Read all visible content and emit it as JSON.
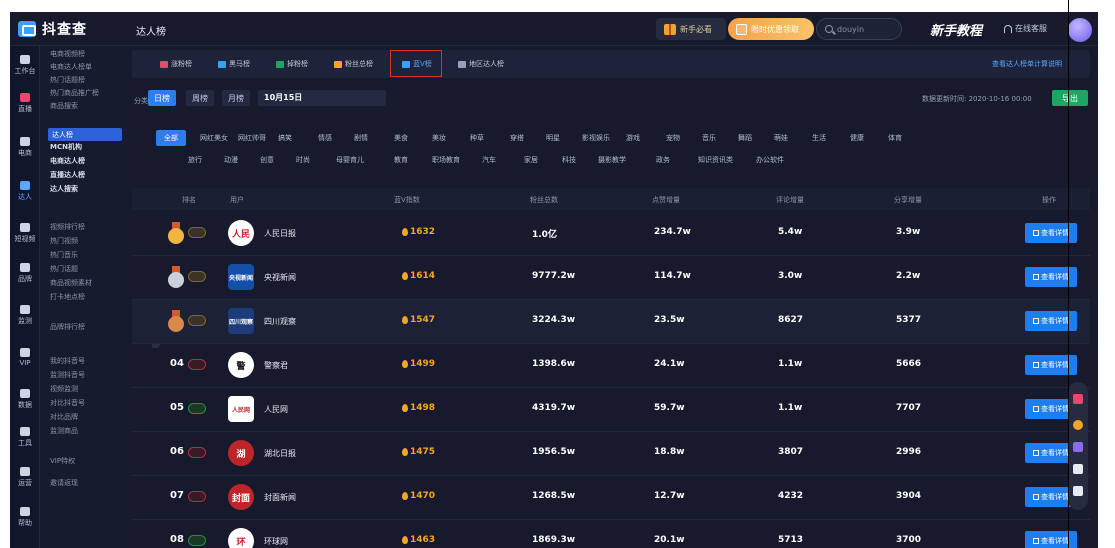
{
  "app": {
    "brand": "抖查查",
    "breadcrumb": "达人榜",
    "beginner_label": "新手必看",
    "promo_label": "限时优惠领取",
    "search_placeholder": "douyin",
    "tutorial_label": "新手教程",
    "service_label": "在线客服"
  },
  "left_nav": [
    {
      "label": "工作台",
      "icon": "grid-icon",
      "active": false
    },
    {
      "label": "直播",
      "icon": "play-icon",
      "active": false
    },
    {
      "label": "电商",
      "icon": "store-icon",
      "active": false
    },
    {
      "label": "达人",
      "icon": "person-icon",
      "active": true
    },
    {
      "label": "短视频",
      "icon": "video-icon",
      "active": false
    },
    {
      "label": "品牌",
      "icon": "brand-icon",
      "active": false
    },
    {
      "label": "监测",
      "icon": "monitor-icon",
      "active": false
    },
    {
      "label": "VIP",
      "icon": "crown-icon",
      "active": false
    },
    {
      "label": "数据",
      "icon": "chart-icon",
      "active": false
    },
    {
      "label": "工具",
      "icon": "tool-icon",
      "active": false
    },
    {
      "label": "运营",
      "icon": "gear-icon",
      "active": false
    },
    {
      "label": "帮助",
      "icon": "help-icon",
      "active": false
    }
  ],
  "sub_nav": [
    "电商视频榜",
    "电商达人榜单",
    "热门话题榜",
    "热门商品推广榜",
    "商品搜索",
    "达人榜",
    "MCN机构",
    "电商达人榜",
    "直播达人榜",
    "达人搜索",
    "视频排行榜",
    "热门视频",
    "热门音乐",
    "热门话题",
    "商品视频素材",
    "打卡地点榜",
    "品牌排行榜",
    "我的抖音号",
    "监测抖音号",
    "视频监测",
    "对比抖音号",
    "对比品牌",
    "监测商品",
    "VIP特权",
    "邀请返现"
  ],
  "tabs": [
    {
      "label": "涨粉榜",
      "color": "#e9486a"
    },
    {
      "label": "黑马榜",
      "color": "#3aa0ff"
    },
    {
      "label": "掉粉榜",
      "color": "#1fa562"
    },
    {
      "label": "粉丝总榜",
      "color": "#f5a524"
    },
    {
      "label": "蓝V榜",
      "color": "#3aa0ff",
      "active": true
    },
    {
      "label": "地区达人榜",
      "color": "#9aa0b6"
    }
  ],
  "tab_right_link": "查看达人榜单计算说明",
  "periods": [
    "日榜",
    "周榜",
    "月榜"
  ],
  "active_period": "日榜",
  "date_value": "10月15日",
  "update_time": "数据更新时间: 2020-10-16 00:00",
  "export_label": "导出",
  "category_label": "分类:",
  "categories_row1": [
    "全部",
    "网红美女",
    "网红帅哥",
    "搞笑",
    "情感",
    "剧情",
    "美食",
    "美妆",
    "种草",
    "穿搭",
    "明星",
    "影视娱乐",
    "游戏",
    "宠物",
    "音乐",
    "舞蹈",
    "萌娃",
    "生活",
    "健康",
    "体育"
  ],
  "categories_row2": [
    "旅行",
    "动漫",
    "创意",
    "时尚",
    "母婴育儿",
    "教育",
    "职场教育",
    "汽车",
    "家居",
    "科技",
    "摄影教学",
    "政务",
    "知识资讯类",
    "办公软件"
  ],
  "table_headers": [
    "排名",
    "用户",
    "蓝V指数",
    "粉丝总数",
    "点赞增量",
    "评论增量",
    "分享增量",
    "操作"
  ],
  "rows": [
    {
      "rank": "",
      "medal": "gold",
      "trend": "same",
      "name": "人民日报",
      "avatar_text": "人民",
      "avatar_bg": "#ffffff",
      "avatar_color": "#c0242b",
      "index": "1632",
      "fans": "1.0亿",
      "likes": "234.7w",
      "comments": "5.4w",
      "shares": "3.9w"
    },
    {
      "rank": "",
      "medal": "silver",
      "trend": "same",
      "name": "央视新闻",
      "avatar_text": "央视新闻",
      "avatar_bg": "#1550a8",
      "avatar_color": "#ffffff",
      "index": "1614",
      "fans": "9777.2w",
      "likes": "114.7w",
      "comments": "3.0w",
      "shares": "2.2w"
    },
    {
      "rank": "",
      "medal": "bronze",
      "trend": "same",
      "name": "四川观察",
      "avatar_text": "四川观察",
      "avatar_bg": "#1d3c7a",
      "avatar_color": "#ffffff",
      "index": "1547",
      "fans": "3224.3w",
      "likes": "23.5w",
      "comments": "8627",
      "shares": "5377"
    },
    {
      "rank": "04",
      "medal": "",
      "trend": "down",
      "name": "警察君",
      "avatar_text": "警",
      "avatar_bg": "#ffffff",
      "avatar_color": "#1a1a1a",
      "index": "1499",
      "fans": "1398.6w",
      "likes": "24.1w",
      "comments": "1.1w",
      "shares": "5666"
    },
    {
      "rank": "05",
      "medal": "",
      "trend": "up",
      "name": "人民网",
      "avatar_text": "人民网",
      "avatar_bg": "#ffffff",
      "avatar_color": "#c0242b",
      "index": "1498",
      "fans": "4319.7w",
      "likes": "59.7w",
      "comments": "1.1w",
      "shares": "7707"
    },
    {
      "rank": "06",
      "medal": "",
      "trend": "down",
      "name": "湖北日报",
      "avatar_text": "湖",
      "avatar_bg": "#c0242b",
      "avatar_color": "#ffffff",
      "index": "1475",
      "fans": "1956.5w",
      "likes": "18.8w",
      "comments": "3807",
      "shares": "2996"
    },
    {
      "rank": "07",
      "medal": "",
      "trend": "down",
      "name": "封面新闻",
      "avatar_text": "封面",
      "avatar_bg": "#c0242b",
      "avatar_color": "#ffffff",
      "index": "1470",
      "fans": "1268.5w",
      "likes": "12.7w",
      "comments": "4232",
      "shares": "3904"
    },
    {
      "rank": "08",
      "medal": "",
      "trend": "up",
      "name": "环球网",
      "avatar_text": "环",
      "avatar_bg": "#ffffff",
      "avatar_color": "#c0242b",
      "index": "1463",
      "fans": "1869.3w",
      "likes": "20.1w",
      "comments": "5713",
      "shares": "3700"
    }
  ],
  "operation_label": "查看详情",
  "colors": {
    "accent": "#2d7df0",
    "background": "#161a2c",
    "index_color": "#f5a524",
    "export_green": "#1fa562",
    "highlight_outline": "#d93030"
  }
}
